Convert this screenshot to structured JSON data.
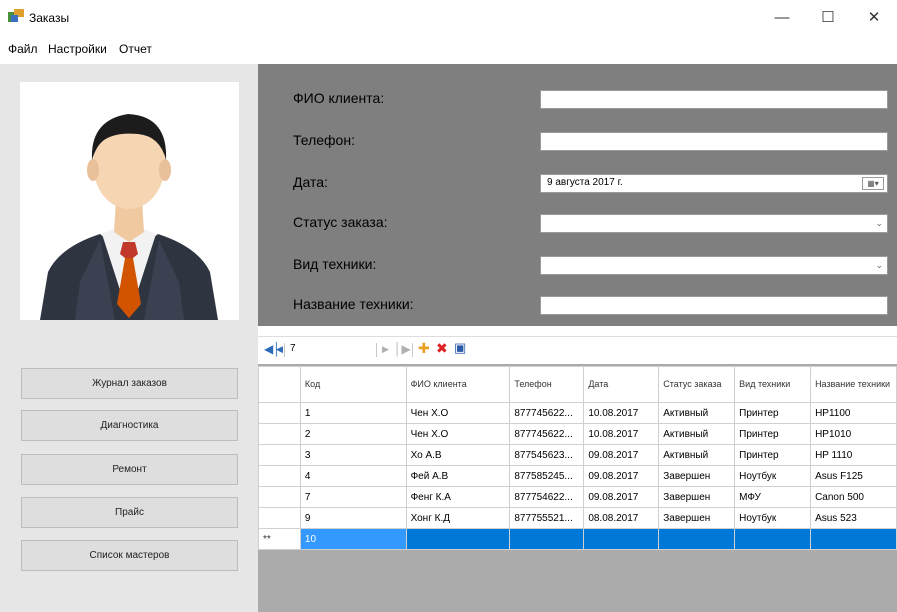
{
  "window": {
    "title": "Заказы"
  },
  "menu": {
    "items": [
      "Файл",
      "Настройки",
      "Отчет"
    ]
  },
  "nav": {
    "buttons": [
      "Журнал заказов",
      "Диагностика",
      "Ремонт",
      "Прайс",
      "Список мастеров"
    ]
  },
  "form": {
    "fio_label": "ФИО клиента:",
    "fio_value": "",
    "phone_label": "Телефон:",
    "phone_value": "",
    "date_label": "Дата:",
    "date_value": "9  августа  2017 г.",
    "status_label": "Статус заказа:",
    "status_value": "",
    "type_label": "Вид техники:",
    "type_value": "",
    "name_label": "Название техники:",
    "name_value": ""
  },
  "navigator": {
    "position": "7"
  },
  "grid": {
    "columns": [
      "Код",
      "ФИО клиента",
      "Телефон",
      "Дата",
      "Статус заказа",
      "Вид техники",
      "Название техники"
    ],
    "rows": [
      [
        "1",
        "Чен Х.О",
        "877745622...",
        "10.08.2017",
        "Активный",
        "Принтер",
        "HP1100"
      ],
      [
        "2",
        "Чен Х.О",
        "877745622...",
        "10.08.2017",
        "Активный",
        "Принтер",
        "HP1010"
      ],
      [
        "3",
        "Хо А.В",
        "877545623...",
        "09.08.2017",
        "Активный",
        "Принтер",
        "HP 1110"
      ],
      [
        "4",
        "Фей А.В",
        "877585245...",
        "09.08.2017",
        "Завершен",
        "Ноутбук",
        "Asus F125"
      ],
      [
        "7",
        "Фенг К.А",
        "877754622...",
        "09.08.2017",
        "Завершен",
        "МФУ",
        "Canon 500"
      ],
      [
        "9",
        "Хонг К.Д",
        "877755521...",
        "08.08.2017",
        "Завершен",
        "Ноутбук",
        "Asus 523"
      ]
    ],
    "new_row_marker": "**",
    "new_row_code": "10"
  },
  "colors": {
    "form_bg": "#7f7f7f",
    "left_bg": "#e6e6e6",
    "selection": "#0078d7"
  }
}
